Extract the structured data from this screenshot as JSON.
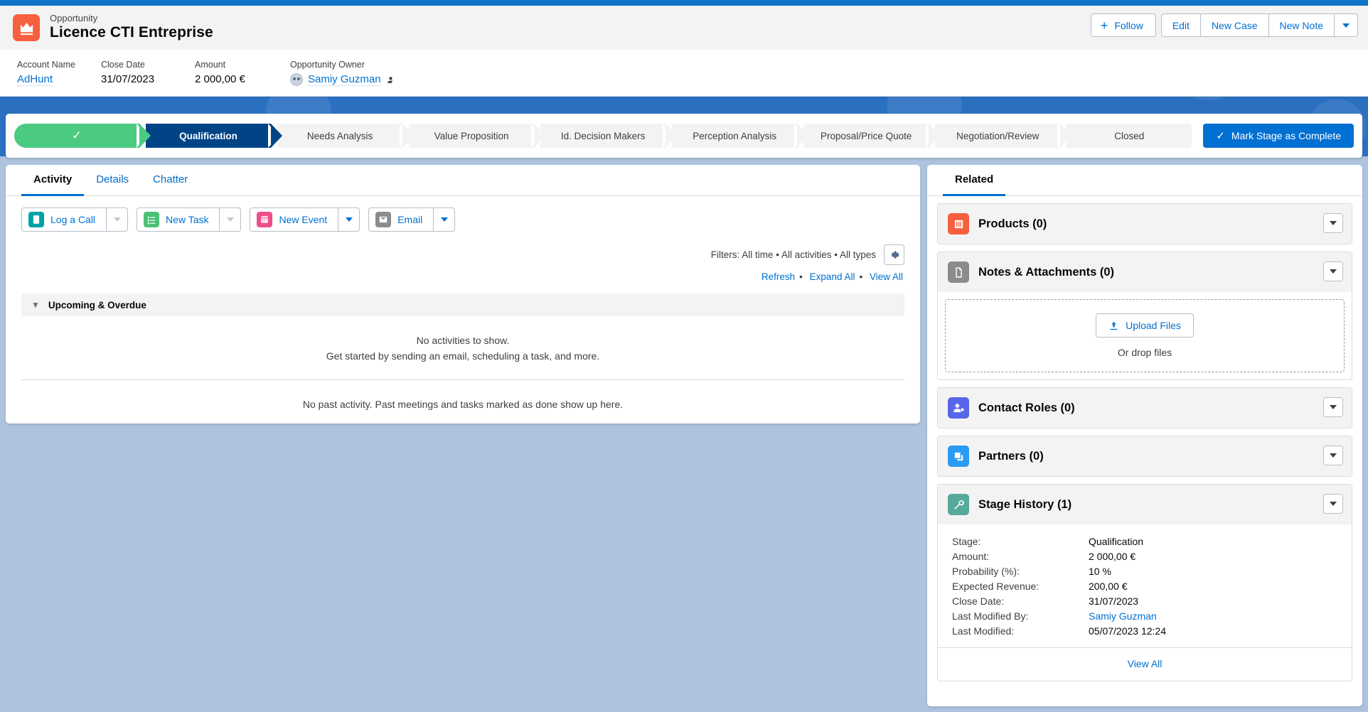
{
  "header": {
    "object_type": "Opportunity",
    "record_title": "Licence CTI Entreprise",
    "object_icon": "crown-icon",
    "actions": {
      "follow": "Follow",
      "edit": "Edit",
      "new_case": "New Case",
      "new_note": "New Note",
      "more": "▾"
    },
    "fields": [
      {
        "label": "Account Name",
        "value": "AdHunt",
        "is_link": true
      },
      {
        "label": "Close Date",
        "value": "31/07/2023",
        "is_link": false
      },
      {
        "label": "Amount",
        "value": "2 000,00 €",
        "is_link": false
      },
      {
        "label": "Opportunity Owner",
        "value": "Samiy Guzman",
        "is_link": true
      }
    ]
  },
  "path": {
    "stages": [
      {
        "label": "",
        "state": "done"
      },
      {
        "label": "Qualification",
        "state": "current"
      },
      {
        "label": "Needs Analysis",
        "state": "upcoming"
      },
      {
        "label": "Value Proposition",
        "state": "upcoming"
      },
      {
        "label": "Id. Decision Makers",
        "state": "upcoming"
      },
      {
        "label": "Perception Analysis",
        "state": "upcoming"
      },
      {
        "label": "Proposal/Price Quote",
        "state": "upcoming"
      },
      {
        "label": "Negotiation/Review",
        "state": "upcoming"
      },
      {
        "label": "Closed",
        "state": "upcoming"
      }
    ],
    "mark_complete": "Mark Stage as Complete"
  },
  "main": {
    "tabs": [
      {
        "label": "Activity",
        "active": true
      },
      {
        "label": "Details",
        "active": false
      },
      {
        "label": "Chatter",
        "active": false
      }
    ],
    "activity_actions": [
      {
        "label": "Log a Call",
        "icon": "phone-icon",
        "color": "#00a3a5",
        "caret_disabled": true
      },
      {
        "label": "New Task",
        "icon": "task-icon",
        "color": "#4bc076",
        "caret_disabled": true
      },
      {
        "label": "New Event",
        "icon": "calendar-icon",
        "color": "#ee4f8b",
        "caret_disabled": false
      },
      {
        "label": "Email",
        "icon": "envelope-icon",
        "color": "#8c8c8c",
        "caret_disabled": false
      }
    ],
    "filters_text": "Filters: All time • All activities • All types",
    "filter_gear_icon": "gear-icon",
    "links": [
      "Refresh",
      "Expand All",
      "View All"
    ],
    "section_title": "Upcoming & Overdue",
    "empty_line_1": "No activities to show.",
    "empty_line_2": "Get started by sending an email, scheduling a task, and more.",
    "empty_past": "No past activity. Past meetings and tasks marked as done show up here."
  },
  "related": {
    "tab_label": "Related",
    "items": [
      {
        "title": "Products (0)",
        "icon": "product-icon",
        "color": "#f7603e"
      },
      {
        "title": "Notes & Attachments (0)",
        "icon": "file-icon",
        "color": "#8c8c8c"
      },
      {
        "title": "Contact Roles (0)",
        "icon": "contact-role-icon",
        "color": "#5867e8"
      },
      {
        "title": "Partners (0)",
        "icon": "partners-icon",
        "color": "#2b9af3"
      },
      {
        "title": "Stage History (1)",
        "icon": "wrench-icon",
        "color": "#56aa9b"
      }
    ],
    "upload": {
      "button_label": "Upload Files",
      "upload_icon": "upload-icon",
      "drop_text": "Or drop files"
    },
    "stage_history": {
      "rows": [
        {
          "key": "Stage:",
          "value": "Qualification",
          "is_link": false
        },
        {
          "key": "Amount:",
          "value": "2 000,00 €",
          "is_link": false
        },
        {
          "key": "Probability (%):",
          "value": "10 %",
          "is_link": false
        },
        {
          "key": "Expected Revenue:",
          "value": "200,00 €",
          "is_link": false
        },
        {
          "key": "Close Date:",
          "value": "31/07/2023",
          "is_link": false
        },
        {
          "key": "Last Modified By:",
          "value": "Samiy Guzman",
          "is_link": true
        },
        {
          "key": "Last Modified:",
          "value": "05/07/2023 12:24",
          "is_link": false
        }
      ],
      "view_all": "View All"
    }
  },
  "colors": {
    "brand_blue": "#0070d2",
    "path_current": "#014486",
    "path_done": "#4bca81",
    "opportunity_orange": "#f7603e",
    "page_bg": "#aec3de"
  }
}
